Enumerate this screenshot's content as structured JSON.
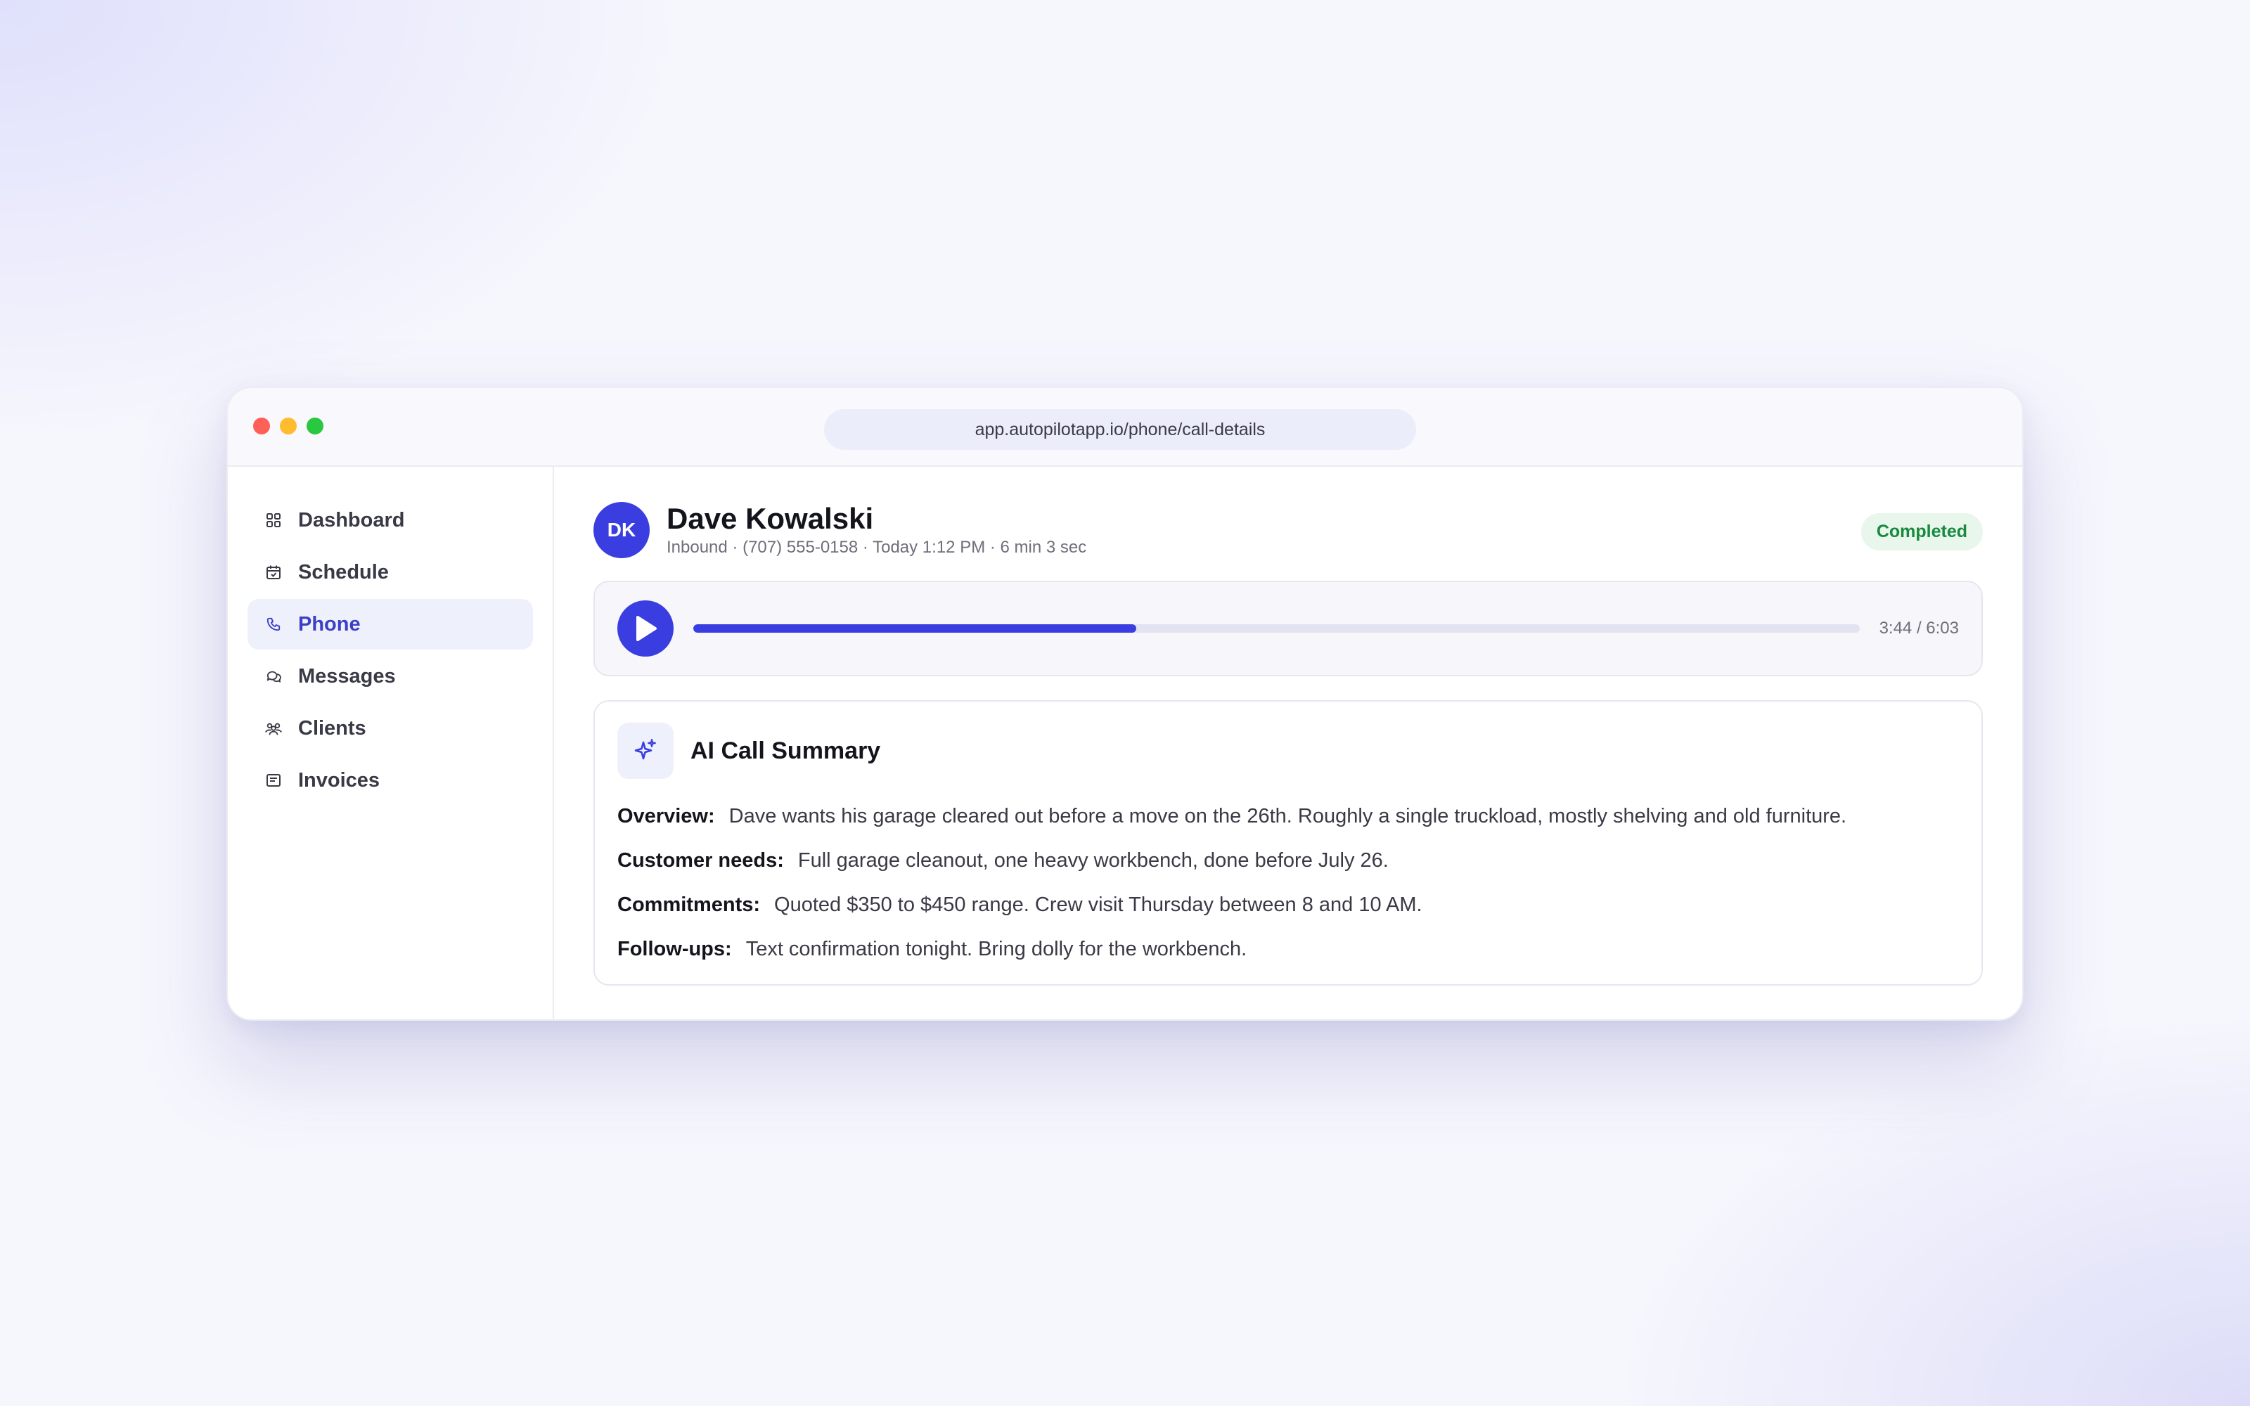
{
  "browser": {
    "url": "app.autopilotapp.io/phone/call-details"
  },
  "sidebar": {
    "items": [
      {
        "label": "Dashboard",
        "icon": "grid-icon"
      },
      {
        "label": "Schedule",
        "icon": "calendar-icon"
      },
      {
        "label": "Phone",
        "icon": "phone-icon",
        "active": true
      },
      {
        "label": "Messages",
        "icon": "chat-bubbles-icon"
      },
      {
        "label": "Clients",
        "icon": "users-icon"
      },
      {
        "label": "Invoices",
        "icon": "invoice-icon"
      }
    ]
  },
  "call": {
    "initials": "DK",
    "name": "Dave Kowalski",
    "meta": "Inbound · (707) 555-0158 · Today 1:12 PM · 6 min 3 sec",
    "status": "Completed"
  },
  "player": {
    "time": "3:44 / 6:03",
    "progress_fraction": 0.38
  },
  "summary": {
    "title": "AI Call Summary",
    "rows": [
      {
        "label": "Overview:",
        "text": "Dave wants his garage cleared out before a move on the 26th. Roughly a single truckload, mostly shelving and old furniture."
      },
      {
        "label": "Customer needs:",
        "text": "Full garage cleanout, one heavy workbench, done before July 26."
      },
      {
        "label": "Commitments:",
        "text": "Quoted $350 to $450 range. Crew visit Thursday between 8 and 10 AM."
      },
      {
        "label": "Follow-ups:",
        "text": "Text confirmation tonight. Bring dolly for the workbench."
      }
    ]
  },
  "colors": {
    "accent": "#3a3ee0",
    "status_green": "#178a3d",
    "status_green_bg": "#e8f6ec"
  }
}
